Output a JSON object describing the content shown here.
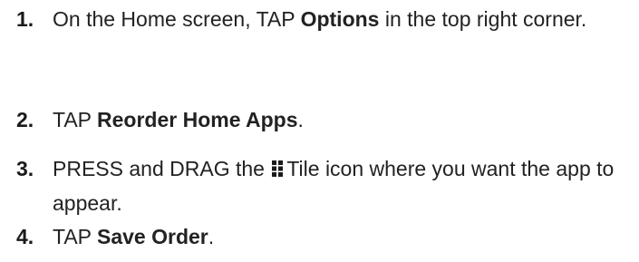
{
  "steps": [
    {
      "number": "1.",
      "text_before": "On the Home screen, TAP ",
      "bold": "Options",
      "text_after": " in the top right corner."
    },
    {
      "number": "2.",
      "text_before": "TAP ",
      "bold": "Reorder Home Apps",
      "text_after": "."
    },
    {
      "number": "3.",
      "text_before": "PRESS and DRAG the ",
      "icon": "tile-grid-icon",
      "text_after": "Tile icon where you want the app to appear."
    },
    {
      "number": "4.",
      "text_before": "TAP ",
      "bold": "Save Order",
      "text_after": "."
    }
  ]
}
